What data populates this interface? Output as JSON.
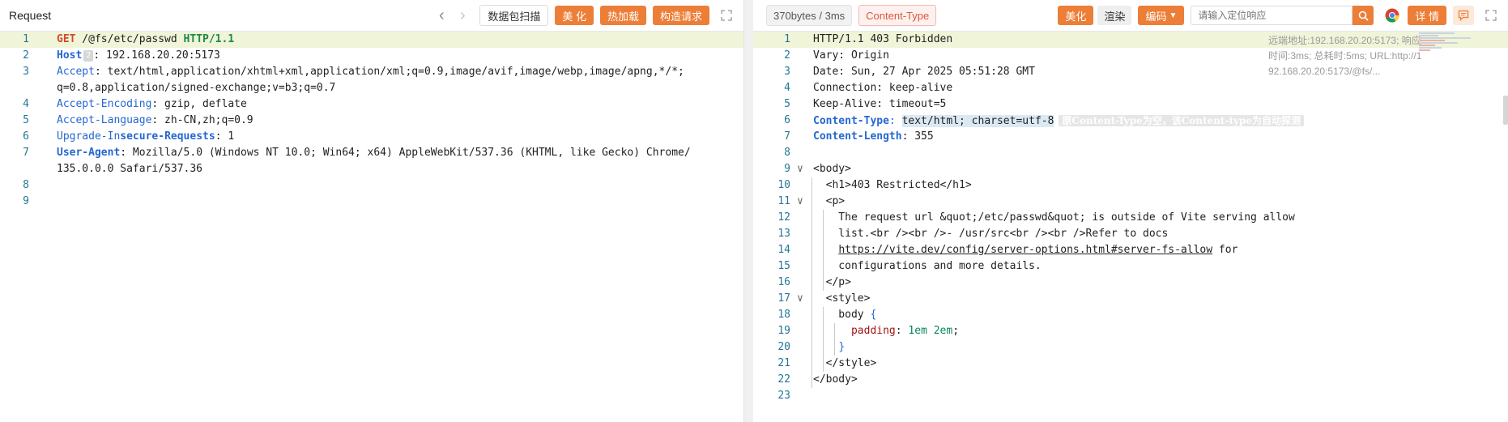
{
  "request": {
    "title": "Request",
    "buttons": {
      "scan": "数据包扫描",
      "beautify": "美 化",
      "hotload": "热加载",
      "construct": "构造请求"
    },
    "host_badge": "2",
    "lines": [
      {
        "n": "1",
        "parts": [
          [
            "GET",
            "kw-red"
          ],
          [
            " /@fs/etc/passwd ",
            ""
          ],
          [
            "HTTP/1.1",
            "kw-green"
          ]
        ]
      },
      {
        "n": "2",
        "parts": [
          [
            "Host",
            "hk-b"
          ],
          [
            ": 192.168.20.20:5173",
            ""
          ]
        ]
      },
      {
        "n": "3",
        "parts": [
          [
            "Accept",
            "hk"
          ],
          [
            ": text/html,application/xhtml+xml,application/xml;q=0.9,image/avif,image/webp,image/apng,*/*;",
            ""
          ]
        ]
      },
      {
        "n": "",
        "parts": [
          [
            "q=0.8,application/signed-exchange;v=b3;q=0.7",
            ""
          ]
        ]
      },
      {
        "n": "4",
        "parts": [
          [
            "Accept-Encoding",
            "hk"
          ],
          [
            ": gzip, deflate",
            ""
          ]
        ]
      },
      {
        "n": "5",
        "parts": [
          [
            "Accept-Language",
            "hk"
          ],
          [
            ": zh-CN,zh;q=0.9",
            ""
          ]
        ]
      },
      {
        "n": "6",
        "parts": [
          [
            "Upgrade-In",
            "hk"
          ],
          [
            "secure-Requests",
            "hk-b"
          ],
          [
            ": 1",
            ""
          ]
        ]
      },
      {
        "n": "7",
        "parts": [
          [
            "User-Agent",
            "hk-b"
          ],
          [
            ": Mozilla/5.0 (Windows NT 10.0; Win64; x64) AppleWebKit/537.36 (KHTML, like Gecko) Chrome/",
            ""
          ]
        ]
      },
      {
        "n": "",
        "parts": [
          [
            "135.0.0.0 Safari/537.36",
            ""
          ]
        ]
      },
      {
        "n": "8",
        "parts": []
      },
      {
        "n": "9",
        "parts": []
      }
    ]
  },
  "response": {
    "size_time": "370bytes / 3ms",
    "content_type_tag": "Content-Type",
    "buttons": {
      "beautify": "美化",
      "render": "渲染",
      "encoding": "编码",
      "detail": "详 情"
    },
    "search_placeholder": "请输入定位响应",
    "remote_info": "远端地址:192.168.20.20:5173; 响应时间:3ms; 总耗时:5ms; URL:http://192.168.20.20:5173/@fs/...",
    "content_type_hint": "原Content-Type为空，该Content-type为自动探测",
    "lines": [
      {
        "n": "1",
        "fold": "",
        "parts": [
          [
            "HTTP/1.1 403 Forbidden",
            ""
          ]
        ]
      },
      {
        "n": "2",
        "fold": "",
        "parts": [
          [
            "Vary: Origin",
            ""
          ]
        ]
      },
      {
        "n": "3",
        "fold": "",
        "parts": [
          [
            "Date: Sun, 27 Apr 2025 05:51:28 GMT",
            ""
          ]
        ]
      },
      {
        "n": "4",
        "fold": "",
        "parts": [
          [
            "Connection: keep-alive",
            ""
          ]
        ]
      },
      {
        "n": "5",
        "fold": "",
        "parts": [
          [
            "Keep-Alive: timeout=5",
            ""
          ]
        ]
      },
      {
        "n": "6",
        "fold": "",
        "parts": [
          [
            "Content-Type",
            "hk-b"
          ],
          [
            ": ",
            "hk"
          ],
          [
            "text/html; charset=utf-8",
            "ct-sel"
          ]
        ]
      },
      {
        "n": "7",
        "fold": "",
        "parts": [
          [
            "Content-Length",
            "hk-b"
          ],
          [
            ": 355",
            ""
          ]
        ]
      },
      {
        "n": "8",
        "fold": "",
        "parts": []
      },
      {
        "n": "9",
        "fold": "v",
        "parts": [
          [
            "<body>",
            ""
          ]
        ]
      },
      {
        "n": "10",
        "fold": "",
        "parts": [
          [
            "  <h1>403 Restricted</h1>",
            ""
          ]
        ]
      },
      {
        "n": "11",
        "fold": "v",
        "parts": [
          [
            "  <p>",
            ""
          ]
        ]
      },
      {
        "n": "12",
        "fold": "",
        "parts": [
          [
            "    The request url &quot;/etc/passwd&quot; is outside of Vite serving allow",
            ""
          ]
        ]
      },
      {
        "n": "13",
        "fold": "",
        "parts": [
          [
            "    list.<br /><br />- /usr/src<br /><br />Refer to docs",
            ""
          ]
        ]
      },
      {
        "n": "14",
        "fold": "",
        "parts": [
          [
            "    ",
            ""
          ],
          [
            "https://vite.dev/config/server-options.html#server-fs-allow",
            "link"
          ],
          [
            " for",
            ""
          ]
        ]
      },
      {
        "n": "15",
        "fold": "",
        "parts": [
          [
            "    configurations and more details.",
            ""
          ]
        ]
      },
      {
        "n": "16",
        "fold": "",
        "parts": [
          [
            "  </p>",
            ""
          ]
        ]
      },
      {
        "n": "17",
        "fold": "v",
        "parts": [
          [
            "  <style>",
            ""
          ]
        ]
      },
      {
        "n": "18",
        "fold": "",
        "parts": [
          [
            "    body ",
            ""
          ],
          [
            "{",
            "hk"
          ]
        ]
      },
      {
        "n": "19",
        "fold": "",
        "parts": [
          [
            "      ",
            ""
          ],
          [
            "padding",
            "attr-key"
          ],
          [
            ": ",
            ""
          ],
          [
            "1em 2em",
            "css-val"
          ],
          [
            ";",
            ""
          ]
        ]
      },
      {
        "n": "20",
        "fold": "",
        "parts": [
          [
            "    ",
            ""
          ],
          [
            "}",
            "hk"
          ]
        ]
      },
      {
        "n": "21",
        "fold": "",
        "parts": [
          [
            "  </style>",
            ""
          ]
        ]
      },
      {
        "n": "22",
        "fold": "",
        "parts": [
          [
            "</body>",
            ""
          ]
        ]
      },
      {
        "n": "23",
        "fold": "",
        "parts": []
      }
    ]
  },
  "icons": {
    "back": "chevron-left-icon",
    "forward": "chevron-right-icon",
    "expand": "expand-icon",
    "search": "search-icon",
    "chrome": "chrome-icon",
    "comment": "comment-icon"
  },
  "colors": {
    "accent": "#ec7e37",
    "line_highlight": "#f0f4d8",
    "method": "#d24b2a",
    "version": "#1d8a45",
    "header_key": "#2567d1"
  }
}
